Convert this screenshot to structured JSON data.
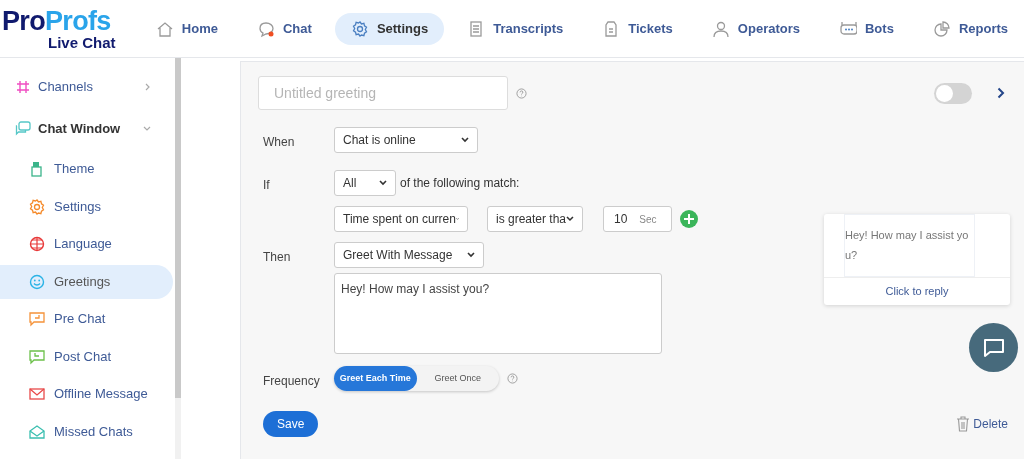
{
  "logo": {
    "brand_a": "Pro",
    "brand_b": "Profs",
    "product": "Live Chat"
  },
  "nav": [
    {
      "label": "Home",
      "selected": false
    },
    {
      "label": "Chat",
      "selected": false
    },
    {
      "label": "Settings",
      "selected": true
    },
    {
      "label": "Transcripts",
      "selected": false
    },
    {
      "label": "Tickets",
      "selected": false
    },
    {
      "label": "Operators",
      "selected": false
    },
    {
      "label": "Bots",
      "selected": false
    },
    {
      "label": "Reports",
      "selected": false
    }
  ],
  "sidebar": {
    "items": [
      {
        "label": "Channels",
        "expanded": false
      },
      {
        "label": "Chat Window",
        "expanded": true,
        "children": [
          {
            "label": "Theme",
            "selected": false
          },
          {
            "label": "Settings",
            "selected": false
          },
          {
            "label": "Language",
            "selected": false
          },
          {
            "label": "Greetings",
            "selected": true
          },
          {
            "label": "Pre Chat",
            "selected": false
          },
          {
            "label": "Post Chat",
            "selected": false
          },
          {
            "label": "Offline Message",
            "selected": false
          },
          {
            "label": "Missed Chats",
            "selected": false
          }
        ]
      }
    ]
  },
  "greeting": {
    "name_placeholder": "Untitled greeting",
    "enabled": false,
    "when": {
      "label": "When",
      "value": "Chat is online"
    },
    "if": {
      "label": "If",
      "match": "All",
      "match_text": "of the following match:",
      "condition": {
        "field": "Time spent on curren",
        "operator": "is greater tha",
        "value": "10",
        "unit": "Sec"
      }
    },
    "then": {
      "label": "Then",
      "action": "Greet With Message",
      "message": "Hey! How may I assist you?"
    },
    "frequency": {
      "label": "Frequency",
      "options": [
        {
          "label": "Greet Each Time",
          "selected": true
        },
        {
          "label": "Greet Once",
          "selected": false
        }
      ]
    },
    "save": "Save",
    "delete": "Delete"
  },
  "preview": {
    "message": "Hey! How may I assist you?",
    "reply": "Click to reply"
  }
}
